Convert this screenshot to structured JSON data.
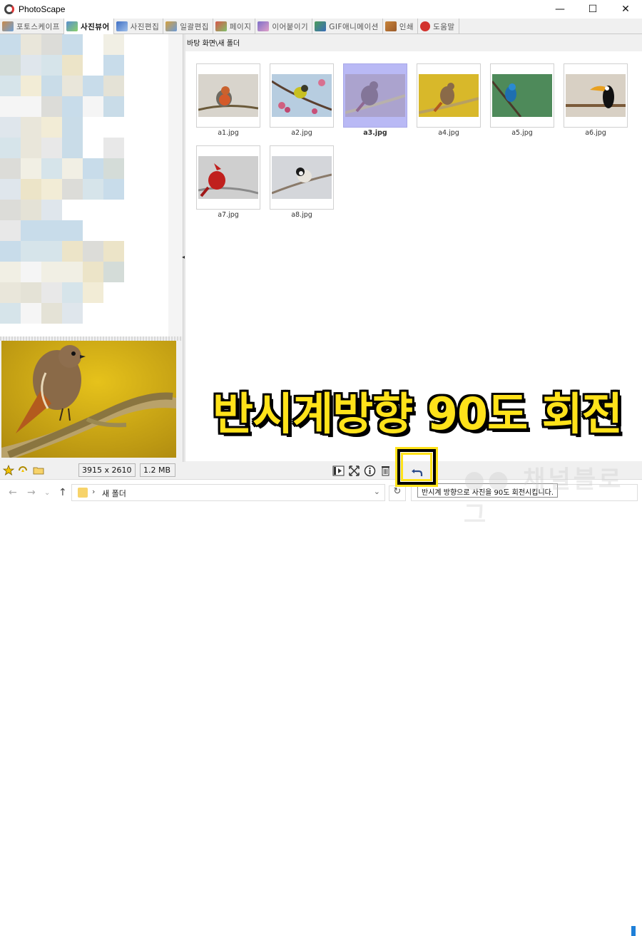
{
  "window": {
    "title": "PhotoScape",
    "controls": {
      "minimize": "—",
      "maximize": "☐",
      "close": "✕"
    }
  },
  "tabs": [
    {
      "label": "포토스케이프",
      "icon": "photoscape-home-icon",
      "active": false
    },
    {
      "label": "사진뷰어",
      "icon": "viewer-icon",
      "active": true
    },
    {
      "label": "사진편집",
      "icon": "editor-icon",
      "active": false
    },
    {
      "label": "일괄편집",
      "icon": "batch-editor-icon",
      "active": false
    },
    {
      "label": "페이지",
      "icon": "page-icon",
      "active": false
    },
    {
      "label": "이어붙이기",
      "icon": "combine-icon",
      "active": false
    },
    {
      "label": "GIF애니메이션",
      "icon": "gif-animation-icon",
      "active": false
    },
    {
      "label": "인쇄",
      "icon": "print-icon",
      "active": false
    },
    {
      "label": "도움말",
      "icon": "help-icon",
      "active": false
    }
  ],
  "browser": {
    "path": "바탕 화면\\새 폴더",
    "thumbnails": [
      {
        "name": "a1.jpg",
        "selected": false
      },
      {
        "name": "a2.jpg",
        "selected": false
      },
      {
        "name": "a3.jpg",
        "selected": true
      },
      {
        "name": "a4.jpg",
        "selected": false
      },
      {
        "name": "a5.jpg",
        "selected": false
      },
      {
        "name": "a6.jpg",
        "selected": false
      },
      {
        "name": "a7.jpg",
        "selected": false
      },
      {
        "name": "a8.jpg",
        "selected": false
      }
    ]
  },
  "status": {
    "dimensions": "3915 x 2610",
    "file_size": "1.2 MB",
    "tooltip": "반시계 방향으로 사진을 90도 회전시킵니다."
  },
  "address_bar": {
    "path": "새 폴더",
    "separator": "›"
  },
  "overlay": {
    "caption": "반시계방향 90도 회전"
  },
  "colors": {
    "caption_fill": "#ffe21a",
    "caption_outline": "#000000",
    "selection": "#b9b9f5",
    "accent": "#1e7fd8"
  }
}
